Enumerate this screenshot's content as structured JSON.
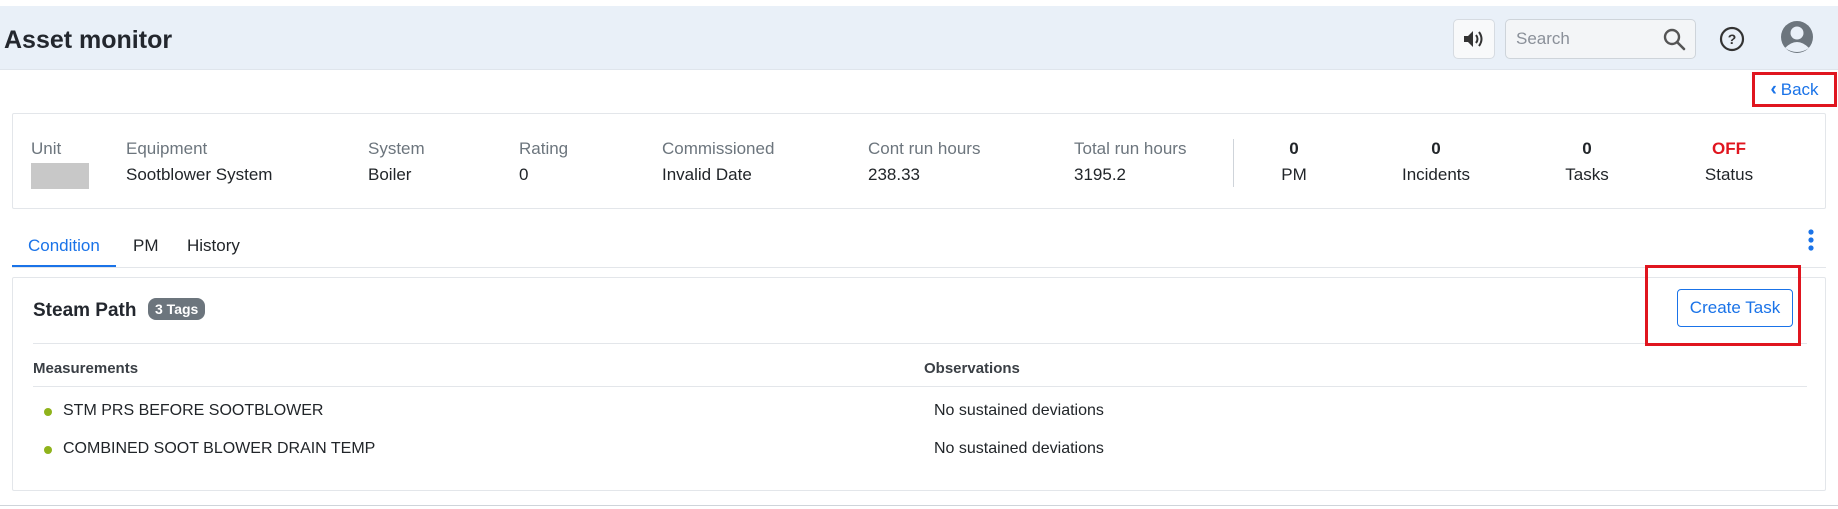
{
  "app": {
    "title": "Asset monitor"
  },
  "header": {
    "search_placeholder": "Search",
    "sound_icon": "speaker-icon",
    "help_icon": "question-circle-icon",
    "avatar_icon": "user-avatar-icon"
  },
  "nav": {
    "back_label": "Back"
  },
  "asset": {
    "fields": [
      {
        "label": "Unit",
        "value": ""
      },
      {
        "label": "Equipment",
        "value": "Sootblower System"
      },
      {
        "label": "System",
        "value": "Boiler"
      },
      {
        "label": "Rating",
        "value": "0"
      },
      {
        "label": "Commissioned",
        "value": "Invalid Date"
      },
      {
        "label": "Cont run hours",
        "value": "238.33"
      },
      {
        "label": "Total run hours",
        "value": "3195.2"
      }
    ],
    "stats": [
      {
        "value": "0",
        "label": "PM"
      },
      {
        "value": "0",
        "label": "Incidents"
      },
      {
        "value": "0",
        "label": "Tasks"
      },
      {
        "value": "OFF",
        "label": "Status"
      }
    ]
  },
  "tabs": [
    {
      "label": "Condition",
      "active": true
    },
    {
      "label": "PM",
      "active": false
    },
    {
      "label": "History",
      "active": false
    }
  ],
  "condition": {
    "group_title": "Steam Path",
    "tags_badge": "3 Tags",
    "create_task_label": "Create Task",
    "columns": {
      "measurements": "Measurements",
      "observations": "Observations"
    },
    "rows": [
      {
        "measurement": "STM PRS BEFORE SOOTBLOWER",
        "observation": "No sustained deviations"
      },
      {
        "measurement": "COMBINED SOOT BLOWER DRAIN TEMP",
        "observation": "No sustained deviations"
      }
    ]
  },
  "colors": {
    "accent": "#1a73e8",
    "status_off": "#e0151f",
    "highlight": "#e0151f",
    "dot": "#8fb31b"
  }
}
